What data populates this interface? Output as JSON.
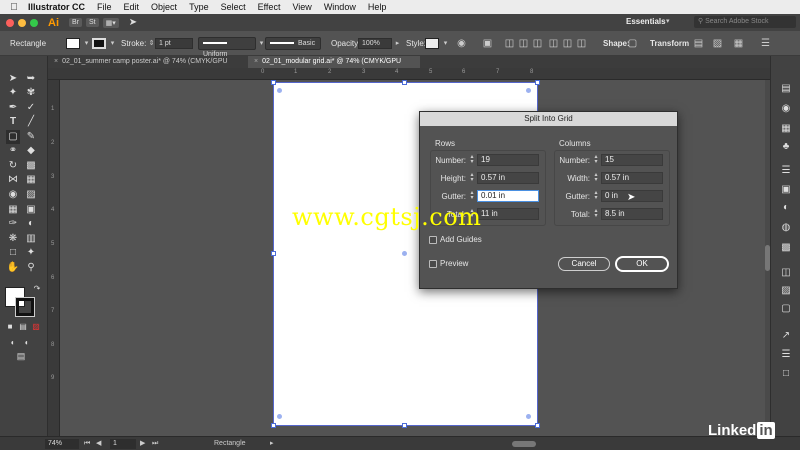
{
  "menubar": {
    "apple_icon": "apple-icon",
    "app_name": "Illustrator CC",
    "items": [
      "File",
      "Edit",
      "Object",
      "Type",
      "Select",
      "Effect",
      "View",
      "Window",
      "Help"
    ]
  },
  "appbar": {
    "logo": "Ai",
    "bridge": "Br",
    "stock": "St",
    "workspace": "Essentials",
    "search_placeholder": "Search Adobe Stock"
  },
  "control": {
    "selection_label": "Rectangle",
    "stroke_label": "Stroke:",
    "stroke_value": "1 pt",
    "uniform_label": "Uniform",
    "basic_label": "Basic",
    "opacity_label": "Opacity:",
    "opacity_value": "100%",
    "style_label": "Style:",
    "shape_label": "Shape:",
    "transform_label": "Transform"
  },
  "tabs": [
    {
      "label": "02_01_summer camp poster.ai* @ 74% (CMYK/GPU Preview)"
    },
    {
      "label": "02_01_modular grid.ai* @ 74% (CMYK/GPU Preview)"
    }
  ],
  "ruler_top": [
    "0",
    "1",
    "2",
    "3",
    "4",
    "5",
    "6",
    "7",
    "8"
  ],
  "ruler_left": [
    "1",
    "2",
    "3",
    "4",
    "5",
    "6",
    "7",
    "8",
    "9"
  ],
  "dialog": {
    "title": "Split Into Grid",
    "rows": {
      "title": "Rows",
      "number_label": "Number:",
      "number_value": "19",
      "height_label": "Height:",
      "height_value": "0.57 in",
      "gutter_label": "Gutter:",
      "gutter_value": "0.01 in",
      "total_label": "Total:",
      "total_value": "11 in"
    },
    "columns": {
      "title": "Columns",
      "number_label": "Number:",
      "number_value": "15",
      "width_label": "Width:",
      "width_value": "0.57 in",
      "gutter_label": "Gutter:",
      "gutter_value": "0 in",
      "total_label": "Total:",
      "total_value": "8.5 in"
    },
    "add_guides_label": "Add Guides",
    "preview_label": "Preview",
    "cancel_label": "Cancel",
    "ok_label": "OK"
  },
  "statusbar": {
    "zoom": "74%",
    "artboard_number": "1",
    "status_text": "Rectangle"
  },
  "watermark": "www.cgtsj.com",
  "brand": {
    "text": "Linked",
    "in": "in"
  },
  "colors": {
    "accent": "#4b6cd8",
    "watermark": "#ffff00",
    "ai_orange": "#ff9a00"
  }
}
